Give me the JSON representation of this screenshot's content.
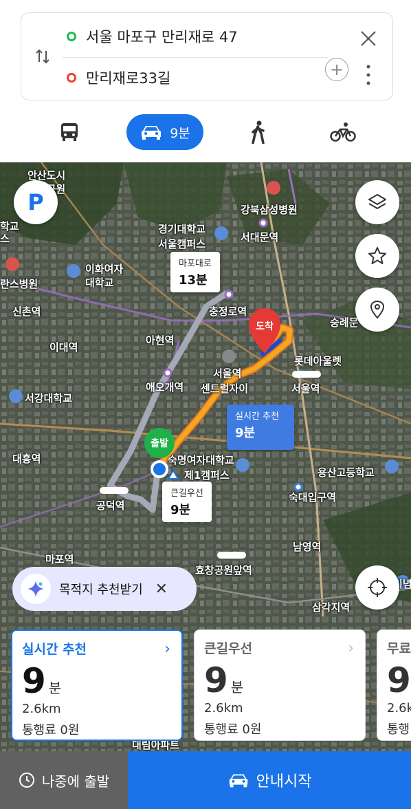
{
  "search": {
    "origin": "서울 마포구 만리재로 47",
    "destination": "만리재로33길"
  },
  "modes": {
    "car_time": "9분",
    "selected": "car"
  },
  "map": {
    "labels": [
      "안산도시",
      "자연공원",
      "학교",
      "스",
      "강북삼성병원",
      "경기대학교",
      "서울캠퍼스",
      "서대문역",
      "이화여자",
      "대학교",
      "란스병원",
      "신촌역",
      "충정로역",
      "숭례문",
      "아현역",
      "이대역",
      "롯데아울렛",
      "애오개역",
      "서울역",
      "센트럴자이",
      "서울역",
      "서강대학교",
      "숙명여자대학교",
      "제1캠퍼스",
      "대흥역",
      "용산고등학교",
      "공덕역",
      "숙대입구역",
      "남영역",
      "마포역",
      "효창공원앞역",
      "삼각지역",
      "대림아파트",
      "기념"
    ],
    "callouts": {
      "mapo": {
        "name": "마포대로",
        "time": "13분"
      },
      "realtime": {
        "name": "실시간 추천",
        "time": "9분"
      },
      "main_road": {
        "name": "큰길우선",
        "time": "9분"
      }
    },
    "start_badge": "출발",
    "end_badge": "도착",
    "parking_label": "P",
    "recommend_label": "목적지 추천받기",
    "route_color": "#f5a623"
  },
  "cards": [
    {
      "title": "실시간 추천",
      "time": "9",
      "unit": "분",
      "distance": "2.6km",
      "toll": "통행료 0원"
    },
    {
      "title": "큰길우선",
      "time": "9",
      "unit": "분",
      "distance": "2.6km",
      "toll": "통행료 0원"
    },
    {
      "title": "무료",
      "time": "9",
      "unit": "분",
      "distance": "2.6km",
      "toll": "통행"
    }
  ],
  "bottom": {
    "later_label": "나중에 출발",
    "start_label": "안내시작"
  }
}
